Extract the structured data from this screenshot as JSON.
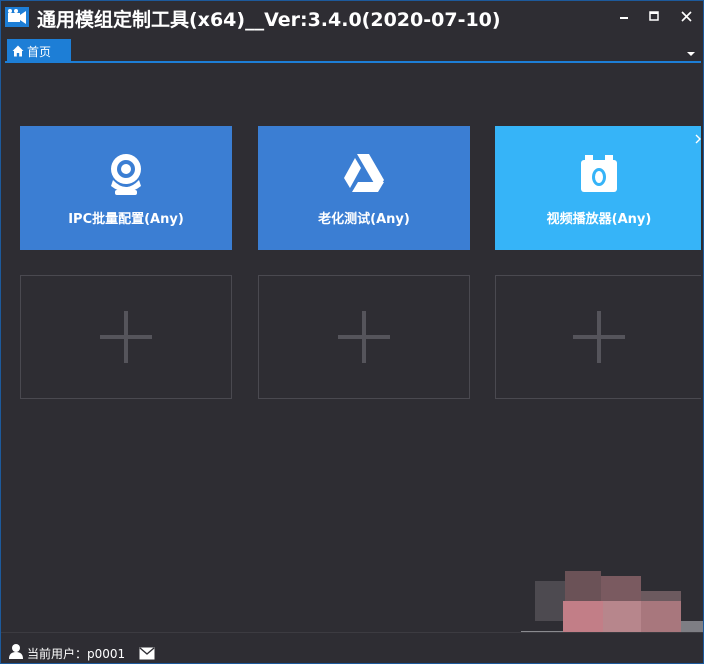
{
  "window": {
    "title": "通用模组定制工具(x64)__Ver:3.4.0(2020-07-10)",
    "accent_color": "#1d7ed6"
  },
  "titlebar": {
    "minimize_icon": "minimize-icon",
    "maximize_icon": "maximize-icon",
    "close_icon": "close-icon"
  },
  "tabs": [
    {
      "label": "首页",
      "icon": "home-icon",
      "active": true
    }
  ],
  "tiles": [
    {
      "label": "IPC批量配置(Any)",
      "icon": "webcam-icon",
      "color": "#3b7ed3"
    },
    {
      "label": "老化测试(Any)",
      "icon": "drive-triangle-icon",
      "color": "#3b7ed3"
    },
    {
      "label": "视频播放器(Any)",
      "icon": "camera-icon",
      "color": "#36b4f8"
    }
  ],
  "placeholders": [
    {
      "icon": "plus-icon"
    },
    {
      "icon": "plus-icon"
    },
    {
      "icon": "plus-icon"
    }
  ],
  "statusbar": {
    "user_text": "当前用户：p0001",
    "user_icon": "user-icon",
    "mail_icon": "mail-icon"
  }
}
